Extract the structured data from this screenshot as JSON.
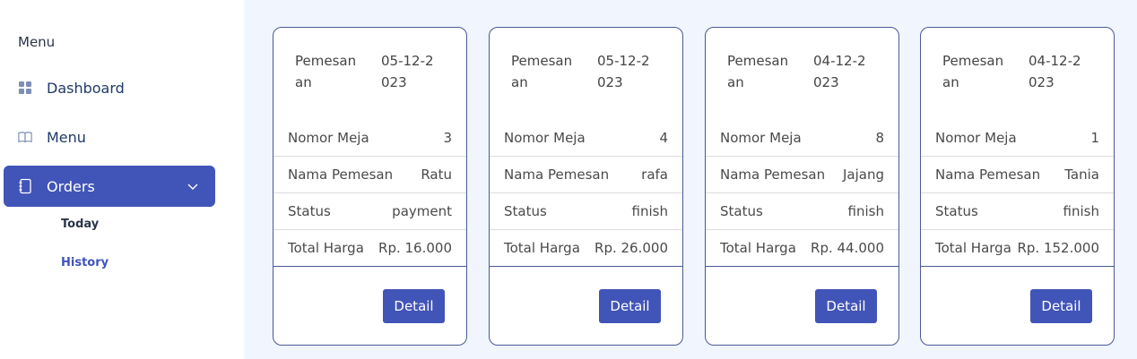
{
  "sidebar": {
    "heading": "Menu",
    "items": [
      {
        "label": "Dashboard",
        "icon": "grid-icon"
      },
      {
        "label": "Menu",
        "icon": "book-icon"
      },
      {
        "label": "Orders",
        "icon": "notebook-icon",
        "active": true
      }
    ],
    "subitems": [
      {
        "label": "Today"
      },
      {
        "label": "History"
      }
    ]
  },
  "cards": [
    {
      "head_label": "Pemesanan",
      "date": "05-12-2023",
      "rows": [
        {
          "label": "Nomor Meja",
          "value": "3"
        },
        {
          "label": "Nama Pemesan",
          "value": "Ratu"
        },
        {
          "label": "Status",
          "value": "payment"
        },
        {
          "label": "Total Harga",
          "value": "Rp. 16.000"
        }
      ],
      "button": "Detail"
    },
    {
      "head_label": "Pemesanan",
      "date": "05-12-2023",
      "rows": [
        {
          "label": "Nomor Meja",
          "value": "4"
        },
        {
          "label": "Nama Pemesan",
          "value": "rafa"
        },
        {
          "label": "Status",
          "value": "finish"
        },
        {
          "label": "Total Harga",
          "value": "Rp. 26.000"
        }
      ],
      "button": "Detail"
    },
    {
      "head_label": "Pemesanan",
      "date": "04-12-2023",
      "rows": [
        {
          "label": "Nomor Meja",
          "value": "8"
        },
        {
          "label": "Nama Pemesan",
          "value": "Jajang"
        },
        {
          "label": "Status",
          "value": "finish"
        },
        {
          "label": "Total Harga",
          "value": "Rp. 44.000"
        }
      ],
      "button": "Detail"
    },
    {
      "head_label": "Pemesanan",
      "date": "04-12-2023",
      "rows": [
        {
          "label": "Nomor Meja",
          "value": "1"
        },
        {
          "label": "Nama Pemesan",
          "value": "Tania"
        },
        {
          "label": "Status",
          "value": "finish"
        },
        {
          "label": "Total Harga",
          "value": "Rp. 152.000"
        }
      ],
      "button": "Detail"
    }
  ],
  "colors": {
    "accent": "#4154b8",
    "background": "#f1f5fd",
    "card_border": "#4a5a96"
  }
}
